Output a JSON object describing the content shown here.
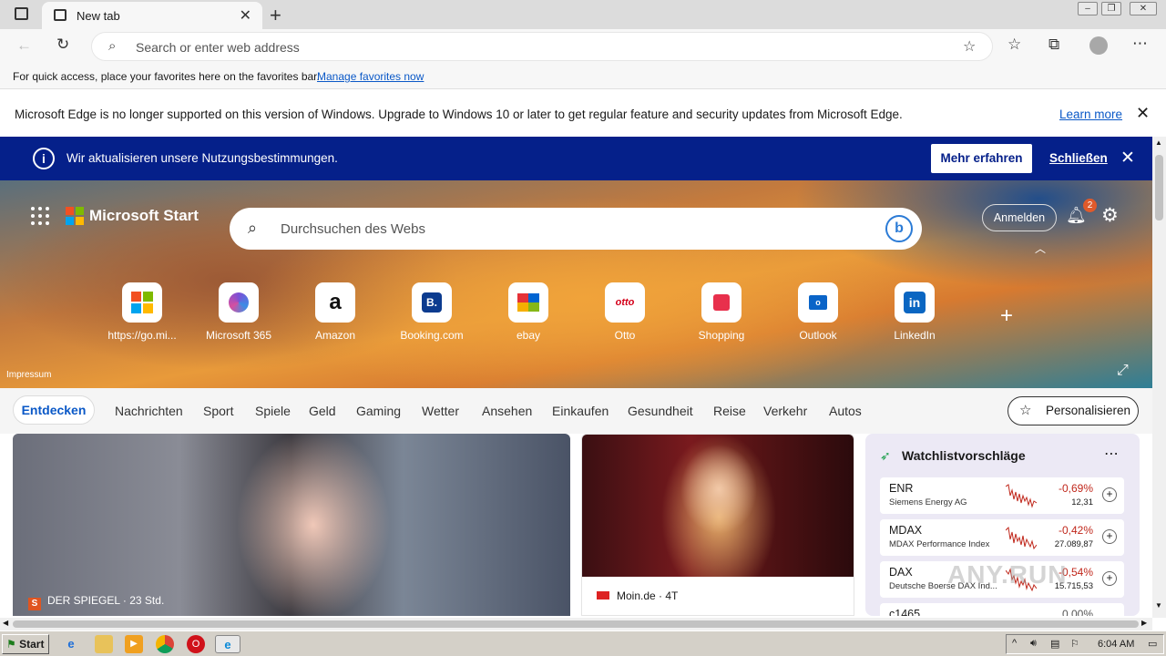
{
  "browser": {
    "tab_title": "New tab",
    "address_placeholder": "Search or enter web address"
  },
  "favbar": {
    "text": "For quick access, place your favorites here on the favorites bar.",
    "link": "Manage favorites now"
  },
  "unsupported": {
    "text": "Microsoft Edge is no longer supported on this version of Windows. Upgrade to Windows 10 or later to get regular feature and security updates from Microsoft Edge.",
    "link": "Learn more"
  },
  "banner": {
    "text": "Wir aktualisieren unsere Nutzungsbestimmungen.",
    "primary": "Mehr erfahren",
    "close": "Schließen"
  },
  "hero": {
    "brand": "Microsoft Start",
    "search_placeholder": "Durchsuchen des Webs",
    "signin": "Anmelden",
    "notifications": "2",
    "impressum": "Impressum",
    "tiles": [
      {
        "label": "https://go.mi...",
        "icon": "microsoft-logo"
      },
      {
        "label": "Microsoft 365",
        "icon": "m365-icon"
      },
      {
        "label": "Amazon",
        "icon": "amazon-icon",
        "glyph": "a"
      },
      {
        "label": "Booking.com",
        "icon": "booking-icon",
        "glyph": "B."
      },
      {
        "label": "ebay",
        "icon": "ebay-bag-icon"
      },
      {
        "label": "Otto",
        "icon": "otto-icon",
        "glyph": "otto"
      },
      {
        "label": "Shopping",
        "icon": "shopping-bag-icon"
      },
      {
        "label": "Outlook",
        "icon": "outlook-icon"
      },
      {
        "label": "LinkedIn",
        "icon": "linkedin-icon",
        "glyph": "in"
      }
    ]
  },
  "nav": {
    "active": "Entdecken",
    "items": [
      "Nachrichten",
      "Sport",
      "Spiele",
      "Geld",
      "Gaming",
      "Wetter",
      "Ansehen",
      "Einkaufen",
      "Gesundheit",
      "Reise",
      "Verkehr",
      "Autos"
    ],
    "personalize": "Personalisieren"
  },
  "cards": {
    "card1_source": "DER SPIEGEL · 23 Std.",
    "card1_logo": "S",
    "card2_source": "Moin.de · 4T"
  },
  "watchlist": {
    "title": "Watchlistvorschläge",
    "stocks": [
      {
        "symbol": "ENR",
        "name": "Siemens Energy AG",
        "change": "-0,69%",
        "price": "12,31"
      },
      {
        "symbol": "MDAX",
        "name": "MDAX Performance Index",
        "change": "-0,42%",
        "price": "27.089,87"
      },
      {
        "symbol": "DAX",
        "name": "Deutsche Boerse DAX Ind...",
        "change": "-0,54%",
        "price": "15.715,53"
      },
      {
        "symbol": "c1465",
        "name": "",
        "change": "0,00%",
        "price": ""
      }
    ]
  },
  "taskbar": {
    "start": "Start",
    "clock": "6:04 AM"
  },
  "watermark": "ANY.RUN",
  "colors": {
    "banner_bg": "#05208a",
    "link": "#0a58c7",
    "negative": "#c0271b"
  }
}
